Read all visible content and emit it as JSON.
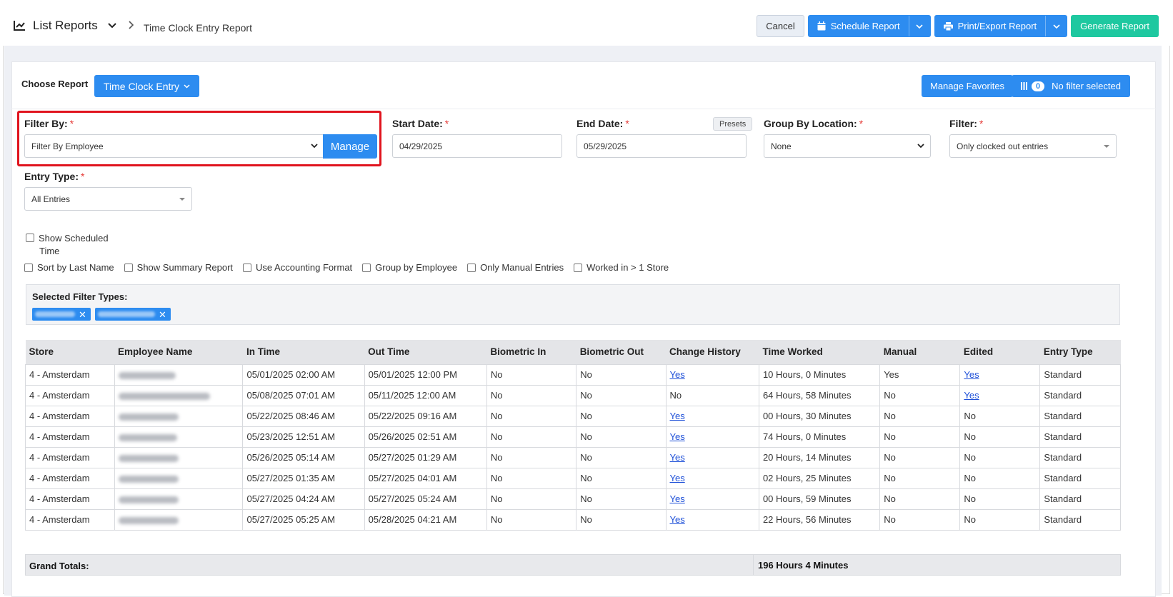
{
  "header": {
    "brand_title": "List Reports",
    "breadcrumb": "Time Clock Entry Report",
    "buttons": {
      "cancel": "Cancel",
      "schedule": "Schedule Report",
      "print_export": "Print/Export Report",
      "generate": "Generate Report"
    }
  },
  "toolbar": {
    "choose_report_label": "Choose Report",
    "report_type": "Time Clock Entry",
    "manage_favorites": "Manage Favorites",
    "filter_count": "0",
    "no_filter": "No filter selected"
  },
  "form": {
    "filter_by": {
      "label": "Filter By:",
      "required": "*",
      "value": "Filter By Employee",
      "manage": "Manage"
    },
    "start_date": {
      "label": "Start Date:",
      "required": "*",
      "value": "04/29/2025"
    },
    "end_date": {
      "label": "End Date:",
      "required": "*",
      "value": "05/29/2025",
      "presets": "Presets"
    },
    "group_by_location": {
      "label": "Group By Location:",
      "required": "*",
      "value": "None"
    },
    "filter": {
      "label": "Filter:",
      "required": "*",
      "value": "Only clocked out entries"
    },
    "entry_type": {
      "label": "Entry Type:",
      "required": "*",
      "value": "All Entries"
    }
  },
  "options": {
    "show_scheduled_line1": "Show Scheduled",
    "show_scheduled_line2": "Time",
    "sort_last_name": "Sort by Last Name",
    "show_summary": "Show Summary Report",
    "accounting_format": "Use Accounting Format",
    "group_employee": "Group by Employee",
    "only_manual": "Only Manual Entries",
    "worked_store": "Worked in > 1 Store"
  },
  "selected_filters": {
    "label": "Selected Filter Types:"
  },
  "table": {
    "columns": [
      "Store",
      "Employee Name",
      "In Time",
      "Out Time",
      "Biometric In",
      "Biometric Out",
      "Change History",
      "Time Worked",
      "Manual",
      "Edited",
      "Entry Type"
    ],
    "rows": [
      [
        "4 - Amsterdam",
        "",
        "05/01/2025 02:00 AM",
        "05/01/2025 12:00 PM",
        "No",
        "No",
        "Yes",
        "10 Hours, 0 Minutes",
        "Yes",
        "Yes",
        "Standard"
      ],
      [
        "4 - Amsterdam",
        "",
        "05/08/2025 07:01 AM",
        "05/11/2025 12:00 AM",
        "No",
        "No",
        "No",
        "64 Hours, 58 Minutes",
        "No",
        "Yes",
        "Standard"
      ],
      [
        "4 - Amsterdam",
        "",
        "05/22/2025 08:46 AM",
        "05/22/2025 09:16 AM",
        "No",
        "No",
        "Yes",
        "00 Hours, 30 Minutes",
        "No",
        "No",
        "Standard"
      ],
      [
        "4 - Amsterdam",
        "",
        "05/23/2025 12:51 AM",
        "05/26/2025 02:51 AM",
        "No",
        "No",
        "Yes",
        "74 Hours, 0 Minutes",
        "No",
        "No",
        "Standard"
      ],
      [
        "4 - Amsterdam",
        "",
        "05/26/2025 05:14 AM",
        "05/27/2025 01:29 AM",
        "No",
        "No",
        "Yes",
        "20 Hours, 14 Minutes",
        "No",
        "No",
        "Standard"
      ],
      [
        "4 - Amsterdam",
        "",
        "05/27/2025 01:35 AM",
        "05/27/2025 04:01 AM",
        "No",
        "No",
        "Yes",
        "02 Hours, 25 Minutes",
        "No",
        "No",
        "Standard"
      ],
      [
        "4 - Amsterdam",
        "",
        "05/27/2025 04:24 AM",
        "05/27/2025 05:24 AM",
        "No",
        "No",
        "Yes",
        "00 Hours, 59 Minutes",
        "No",
        "No",
        "Standard"
      ],
      [
        "4 - Amsterdam",
        "",
        "05/27/2025 05:25 AM",
        "05/28/2025 04:21 AM",
        "No",
        "No",
        "Yes",
        "22 Hours, 56 Minutes",
        "No",
        "No",
        "Standard"
      ]
    ],
    "grand_totals_label": "Grand Totals:",
    "grand_totals_value": "196 Hours 4 Minutes"
  },
  "colors": {
    "primary": "#2d8cf0",
    "teal": "#1ec8a0",
    "highlight": "#e0141e",
    "link": "#1d4fd8"
  }
}
